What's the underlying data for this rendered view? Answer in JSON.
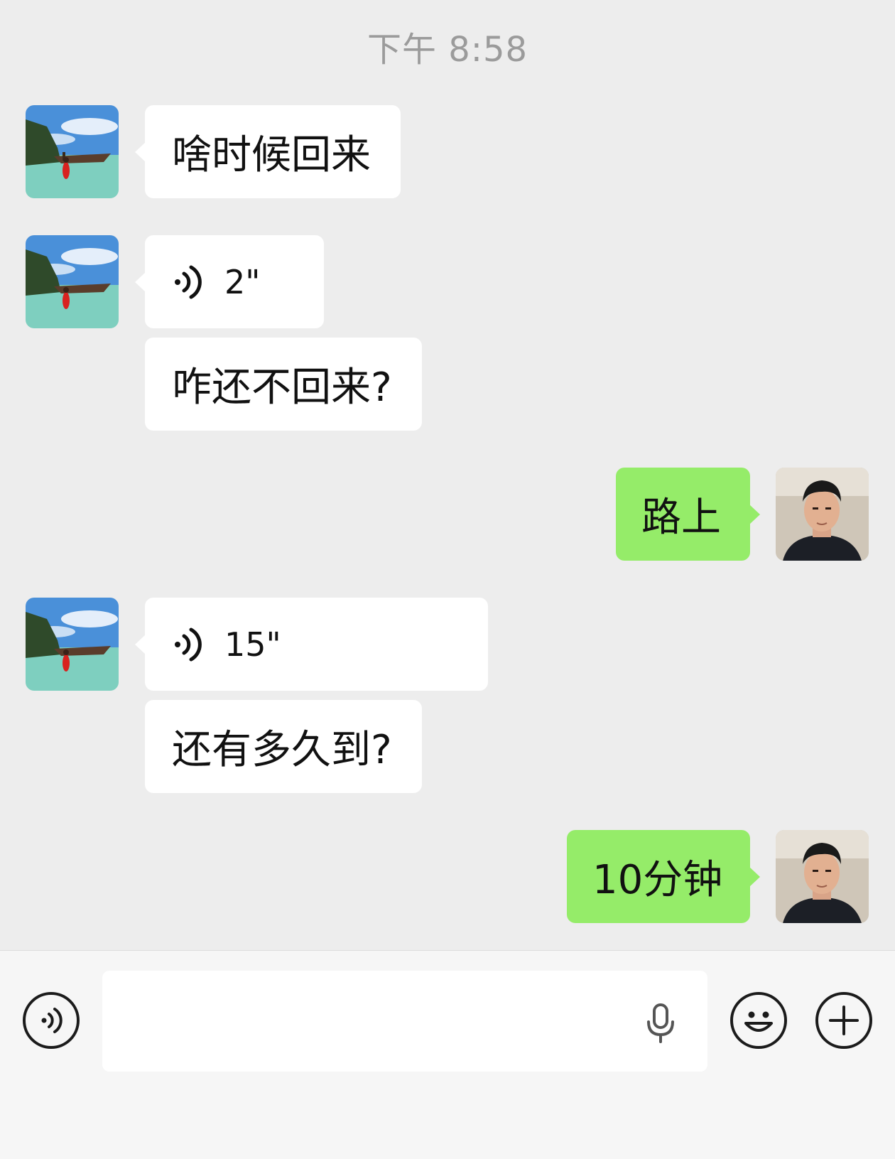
{
  "chat": {
    "timestamp": "下午 8:58",
    "messages": [
      {
        "from": "contact",
        "type": "text",
        "text": "啥时候回来"
      },
      {
        "from": "contact",
        "type": "voice",
        "duration": "2\""
      },
      {
        "from": "contact",
        "type": "text",
        "text": "咋还不回来?"
      },
      {
        "from": "me",
        "type": "text",
        "text": "路上"
      },
      {
        "from": "contact",
        "type": "voice",
        "duration": "15\""
      },
      {
        "from": "contact",
        "type": "text",
        "text": "还有多久到?"
      },
      {
        "from": "me",
        "type": "text",
        "text": "10分钟"
      }
    ]
  },
  "input_bar": {
    "text_value": "",
    "icons": [
      "voice-mode-icon",
      "microphone-icon",
      "emoji-icon",
      "plus-icon"
    ]
  },
  "colors": {
    "chat_background": "#ededed",
    "incoming_bubble": "#ffffff",
    "outgoing_bubble": "#95ec69",
    "timestamp_text": "#9b9b9b",
    "input_bar_background": "#f6f6f6"
  }
}
